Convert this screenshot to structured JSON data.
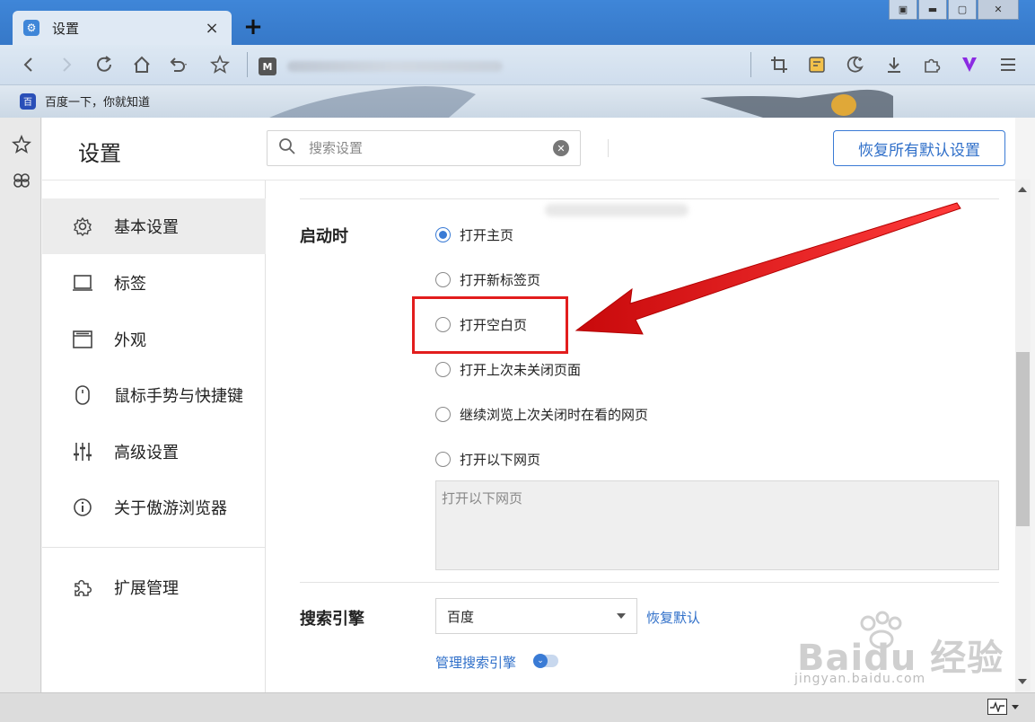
{
  "tab": {
    "title": "设置",
    "close": "×",
    "new_tab": "+"
  },
  "window_controls": {
    "layout": "▣",
    "minimize": "▬",
    "maximize": "▢",
    "close": "✕"
  },
  "bookmarks": {
    "baidu_label": "百度一下，你就知道",
    "baidu_icon": "百"
  },
  "address": {
    "logo": "M"
  },
  "header": {
    "title": "设置",
    "search_placeholder": "搜索设置",
    "reset_label": "恢复所有默认设置"
  },
  "sidebar": {
    "items": [
      {
        "label": "基本设置",
        "icon": "gear-icon",
        "glyph": "⚙"
      },
      {
        "label": "标签",
        "icon": "tab-icon",
        "glyph": "▭"
      },
      {
        "label": "外观",
        "icon": "window-icon",
        "glyph": "▤"
      },
      {
        "label": "鼠标手势与快捷键",
        "icon": "mouse-icon",
        "glyph": "◯"
      },
      {
        "label": "高级设置",
        "icon": "sliders-icon",
        "glyph": "⫶"
      },
      {
        "label": "关于傲游浏览器",
        "icon": "info-icon",
        "glyph": "ⓘ"
      },
      {
        "label": "扩展管理",
        "icon": "puzzle-icon",
        "glyph": "✣"
      }
    ]
  },
  "startup": {
    "label": "启动时",
    "options": [
      {
        "label": "打开主页",
        "checked": true
      },
      {
        "label": "打开新标签页",
        "checked": false
      },
      {
        "label": "打开空白页",
        "checked": false
      },
      {
        "label": "打开上次未关闭页面",
        "checked": false
      },
      {
        "label": "继续浏览上次关闭时在看的网页",
        "checked": false
      },
      {
        "label": "打开以下网页",
        "checked": false
      }
    ],
    "urls_placeholder": "打开以下网页"
  },
  "search_engine": {
    "label": "搜索引擎",
    "selected": "百度",
    "restore_default": "恢复默认",
    "manage": "管理搜索引擎"
  },
  "watermark": {
    "brand": "Baidu 经验",
    "url": "jingyan.baidu.com"
  },
  "colors": {
    "accent": "#3a7bd5",
    "annotation": "#e21d1d",
    "titlebar": "#3f86d8"
  }
}
